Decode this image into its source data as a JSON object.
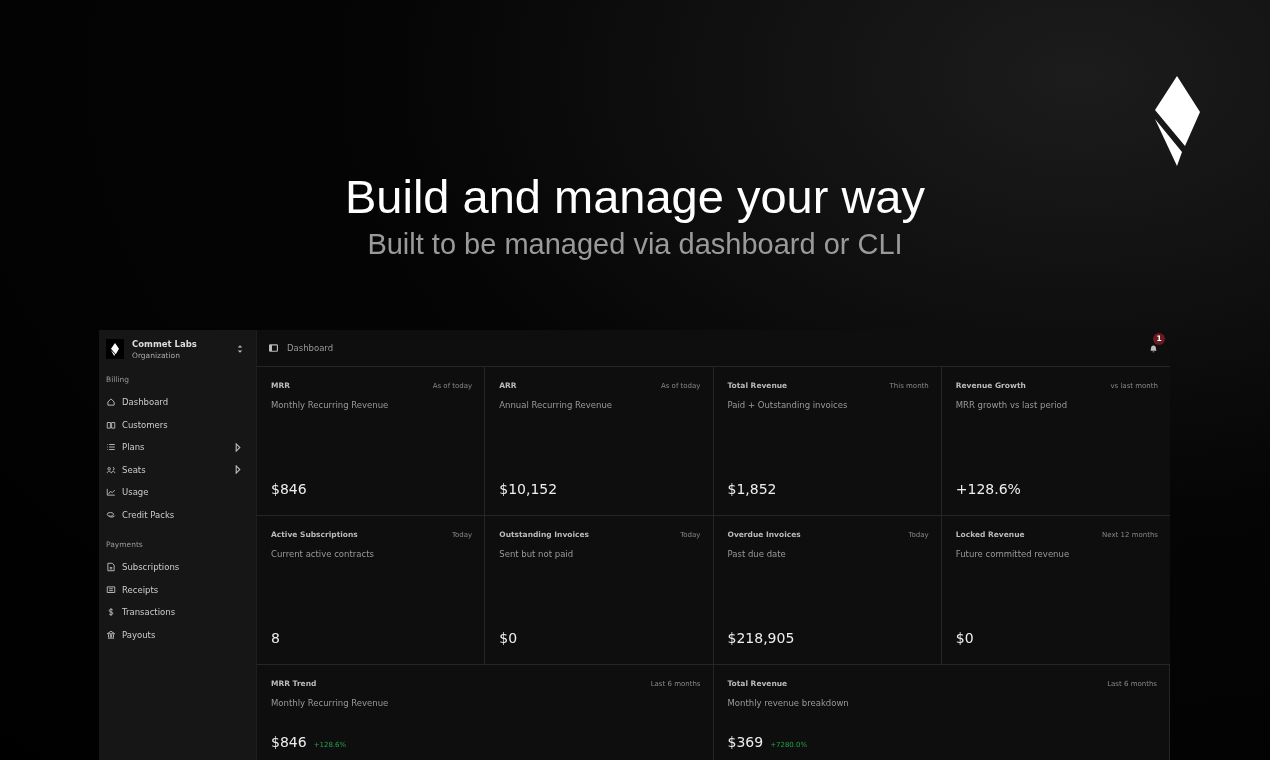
{
  "hero": {
    "title": "Build and manage your way",
    "subtitle": "Built to be managed via dashboard or CLI"
  },
  "sidebar": {
    "org": {
      "name": "Commet Labs",
      "type": "Organization"
    },
    "sections": [
      {
        "label": "Billing",
        "items": [
          {
            "label": "Dashboard",
            "submenu": false
          },
          {
            "label": "Customers",
            "submenu": false
          },
          {
            "label": "Plans",
            "submenu": true
          },
          {
            "label": "Seats",
            "submenu": true
          },
          {
            "label": "Usage",
            "submenu": false
          },
          {
            "label": "Credit Packs",
            "submenu": false
          }
        ]
      },
      {
        "label": "Payments",
        "items": [
          {
            "label": "Subscriptions",
            "submenu": false
          },
          {
            "label": "Receipts",
            "submenu": false
          },
          {
            "label": "Transactions",
            "submenu": false
          },
          {
            "label": "Payouts",
            "submenu": false
          }
        ]
      }
    ]
  },
  "topbar": {
    "breadcrumb": "Dashboard",
    "notifications": "1"
  },
  "metric_cards": [
    {
      "title": "MRR",
      "period": "As of today",
      "subtitle": "Monthly Recurring Revenue",
      "value": "$846"
    },
    {
      "title": "ARR",
      "period": "As of today",
      "subtitle": "Annual Recurring Revenue",
      "value": "$10,152"
    },
    {
      "title": "Total Revenue",
      "period": "This month",
      "subtitle": "Paid + Outstanding invoices",
      "value": "$1,852"
    },
    {
      "title": "Revenue Growth",
      "period": "vs last month",
      "subtitle": "MRR growth vs last period",
      "value": "+128.6%"
    },
    {
      "title": "Active Subscriptions",
      "period": "Today",
      "subtitle": "Current active contracts",
      "value": "8"
    },
    {
      "title": "Outstanding Invoices",
      "period": "Today",
      "subtitle": "Sent but not paid",
      "value": "$0"
    },
    {
      "title": "Overdue Invoices",
      "period": "Today",
      "subtitle": "Past due date",
      "value": "$218,905"
    },
    {
      "title": "Locked Revenue",
      "period": "Next 12 months",
      "subtitle": "Future committed revenue",
      "value": "$0"
    }
  ],
  "trend_cards": [
    {
      "title": "MRR Trend",
      "period": "Last 6 months",
      "subtitle": "Monthly Recurring Revenue",
      "value": "$846",
      "change": "+128.6%"
    },
    {
      "title": "Total Revenue",
      "period": "Last 6 months",
      "subtitle": "Monthly revenue breakdown",
      "value": "$369",
      "change": "+7280.0%"
    }
  ]
}
